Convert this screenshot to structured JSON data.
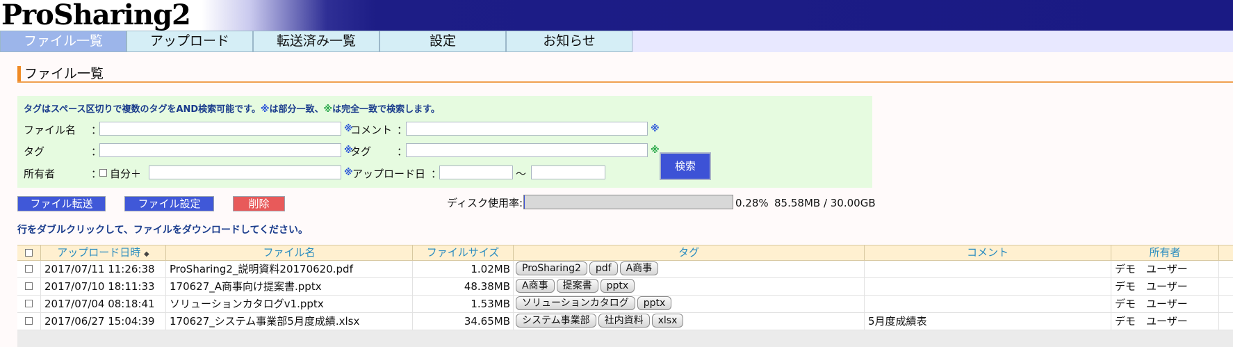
{
  "app": {
    "logo_text": "ProSharing2"
  },
  "nav": {
    "tabs": [
      {
        "label": "ファイル一覧",
        "active": true
      },
      {
        "label": "アップロード",
        "active": false
      },
      {
        "label": "転送済み一覧",
        "active": false
      },
      {
        "label": "設定",
        "active": false
      },
      {
        "label": "お知らせ",
        "active": false
      }
    ]
  },
  "page": {
    "title": "ファイル一覧"
  },
  "search": {
    "hint": {
      "text_before": "タグはスペース区切りで複数のタグをAND検索可能です。",
      "mark_partial": "※",
      "partial": "は部分一致、",
      "mark_exact": "※",
      "exact": "は完全一致で検索します。"
    },
    "labels": {
      "filename": "ファイル名",
      "comment": "コメント",
      "tag": "タグ",
      "tag2": "タグ",
      "owner": "所有者",
      "self": "自分＋",
      "upload_date": "アップロード日",
      "colon": "：",
      "range": "～"
    },
    "values": {
      "filename": "",
      "comment": "",
      "tag": "",
      "tag2": "",
      "owner": "",
      "date_from": "",
      "date_to": ""
    },
    "marks": {
      "partial": "※",
      "exact": "※"
    },
    "search_button": "検索"
  },
  "actions": {
    "transfer": "ファイル転送",
    "settings": "ファイル設定",
    "delete": "削除"
  },
  "disk": {
    "label": "ディスク使用率:",
    "percent_text": "0.28%",
    "percent_value": 0.28,
    "size_text": "85.58MB / 30.00GB"
  },
  "note": "行をダブルクリックして、ファイルをダウンロードしてください。",
  "table": {
    "columns": {
      "upload_date": "アップロード日時",
      "sort_icon": "◆",
      "filename": "ファイル名",
      "size": "ファイルサイズ",
      "tags": "タグ",
      "comment": "コメント",
      "owner": "所有者"
    },
    "rows": [
      {
        "date": "2017/07/11 11:26:38",
        "filename": "ProSharing2_説明資料20170620.pdf",
        "size": "1.02MB",
        "tags": [
          "ProSharing2",
          "pdf",
          "A商事"
        ],
        "comment": "",
        "owner": "デモ　ユーザー"
      },
      {
        "date": "2017/07/10 18:11:33",
        "filename": "170627_A商事向け提案書.pptx",
        "size": "48.38MB",
        "tags": [
          "A商事",
          "提案書",
          "pptx"
        ],
        "comment": "",
        "owner": "デモ　ユーザー"
      },
      {
        "date": "2017/07/04 08:18:41",
        "filename": "ソリューションカタログv1.pptx",
        "size": "1.53MB",
        "tags": [
          "ソリューションカタログ",
          "pptx"
        ],
        "comment": "",
        "owner": "デモ　ユーザー"
      },
      {
        "date": "2017/06/27 15:04:39",
        "filename": "170627_システム事業部5月度成績.xlsx",
        "size": "34.65MB",
        "tags": [
          "システム事業部",
          "社内資料",
          "xlsx"
        ],
        "comment": "5月度成績表",
        "owner": "デモ　ユーザー"
      }
    ]
  },
  "colors": {
    "accent": "#3d52d6",
    "delete": "#e85a5a",
    "header": "#1a1a84",
    "search_bg": "#e6fbe0"
  }
}
